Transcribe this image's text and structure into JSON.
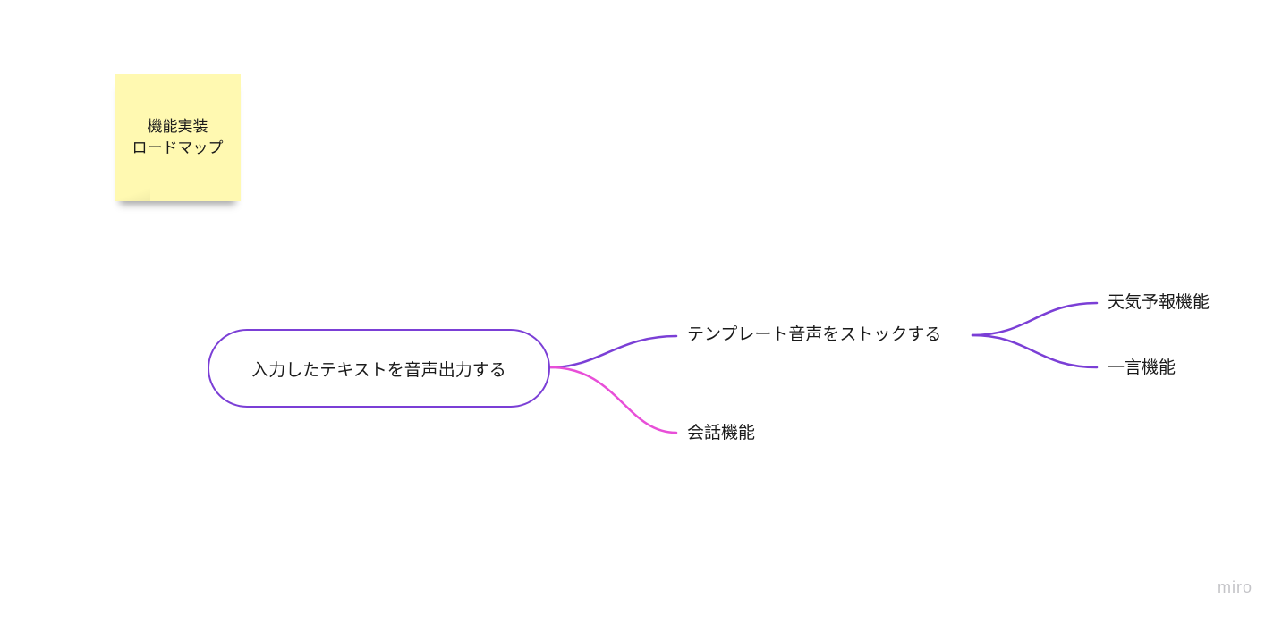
{
  "sticky_note": {
    "line1": "機能実装",
    "line2": "ロードマップ",
    "color": "#fff9b1"
  },
  "mindmap": {
    "root": {
      "label": "入力したテキストを音声出力する",
      "border_color": "#7b3fd6"
    },
    "branches": [
      {
        "label": "テンプレート音声をストックする",
        "line_color": "#7b3fd6",
        "children": [
          {
            "label": "天気予報機能",
            "line_color": "#7b3fd6"
          },
          {
            "label": "一言機能",
            "line_color": "#7b3fd6"
          }
        ]
      },
      {
        "label": "会話機能",
        "line_color": "#e84fd8",
        "children": []
      }
    ]
  },
  "watermark": "miro"
}
